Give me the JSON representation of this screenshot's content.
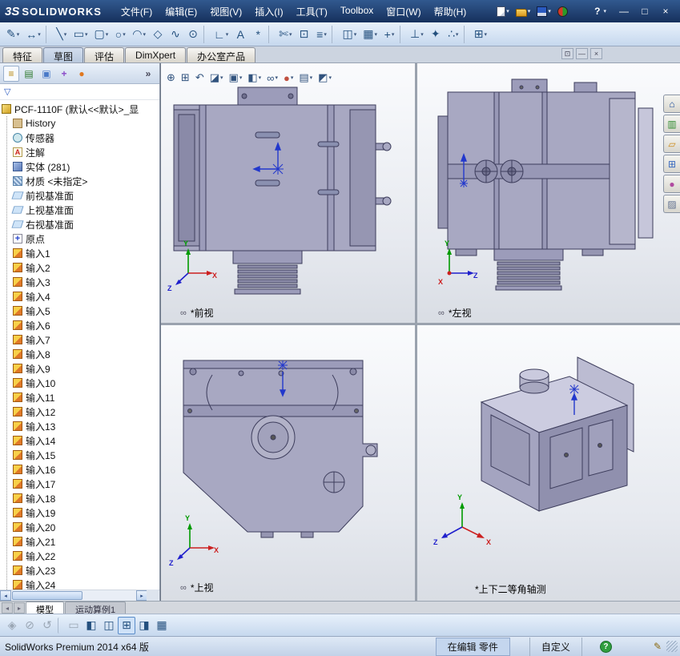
{
  "ui": {
    "caret": "▾",
    "arrow_up": "▴",
    "arrow_down": "▾",
    "arrow_left": "◂",
    "arrow_right": "▸"
  },
  "axis": {
    "x": "X",
    "y": "Y",
    "z": "Z"
  },
  "icons": {
    "view_icon": "∞",
    "filter_icon": "▽",
    "grip": ""
  },
  "titlebar": {
    "logo_mark": "3S",
    "logo_text": "SOLIDWORKS",
    "menus": [
      "文件(F)",
      "编辑(E)",
      "视图(V)",
      "插入(I)",
      "工具(T)",
      "Toolbox",
      "窗口(W)",
      "帮助(H)"
    ],
    "icons": [
      {
        "name": "new-document-icon",
        "type": "page",
        "caret": true
      },
      {
        "name": "open-icon",
        "type": "folder",
        "caret": true
      },
      {
        "name": "save-icon",
        "type": "disk",
        "caret": true
      },
      {
        "name": "options-icon",
        "type": "rg",
        "caret": false
      }
    ],
    "help": "?",
    "window_buttons": [
      {
        "name": "minimize-button",
        "glyph": "—"
      },
      {
        "name": "maximize-button",
        "glyph": "□"
      },
      {
        "name": "close-button",
        "glyph": "×"
      }
    ]
  },
  "toolbar": {
    "icons": [
      {
        "name": "sketch-icon",
        "glyph": "✎",
        "caret": true
      },
      {
        "name": "smart-dimension-icon",
        "glyph": "↔",
        "caret": true
      },
      {
        "name": "separator",
        "sep": true,
        "cls": "sep"
      },
      {
        "name": "line-icon",
        "glyph": "╲",
        "caret": true
      },
      {
        "name": "rectangle-icon",
        "glyph": "▭",
        "caret": true
      },
      {
        "name": "slot-icon",
        "glyph": "▢",
        "caret": true
      },
      {
        "name": "circle-icon",
        "glyph": "○",
        "caret": true
      },
      {
        "name": "arc-icon",
        "glyph": "◠",
        "caret": true
      },
      {
        "name": "polygon-icon",
        "glyph": "◇",
        "caret": false
      },
      {
        "name": "spline-icon",
        "glyph": "∿",
        "caret": false
      },
      {
        "name": "ellipse-icon",
        "glyph": "⊙",
        "caret": false
      },
      {
        "name": "separator",
        "sep": true,
        "cls": "sep"
      },
      {
        "name": "sketch-fillet-icon",
        "glyph": "∟",
        "caret": true
      },
      {
        "name": "text-icon",
        "glyph": "A",
        "caret": false
      },
      {
        "name": "point-icon",
        "glyph": "*",
        "caret": false
      },
      {
        "name": "separator",
        "sep": true,
        "cls": "sep"
      },
      {
        "name": "trim-entities-icon",
        "glyph": "✄",
        "caret": true
      },
      {
        "name": "convert-entities-icon",
        "glyph": "⊡",
        "caret": false
      },
      {
        "name": "offset-entities-icon",
        "glyph": "≡",
        "caret": true
      },
      {
        "name": "separator",
        "sep": true,
        "cls": "sep"
      },
      {
        "name": "mirror-entities-icon",
        "glyph": "◫",
        "caret": true
      },
      {
        "name": "linear-pattern-icon",
        "glyph": "▦",
        "caret": true
      },
      {
        "name": "move-entities-icon",
        "glyph": "+",
        "caret": true
      },
      {
        "name": "separator",
        "sep": true,
        "cls": "sep"
      },
      {
        "name": "display-relations-icon",
        "glyph": "⊥",
        "caret": true
      },
      {
        "name": "repair-sketch-icon",
        "glyph": "✦",
        "caret": false
      },
      {
        "name": "quick-snaps-icon",
        "glyph": "∴",
        "caret": true
      },
      {
        "name": "separator",
        "sep": true,
        "cls": "sep"
      },
      {
        "name": "grid-settings-icon",
        "glyph": "⊞",
        "caret": true
      }
    ]
  },
  "ribbon": {
    "tabs": [
      {
        "label": "特征",
        "cls": ""
      },
      {
        "label": "草图",
        "cls": "active"
      },
      {
        "label": "评估",
        "cls": ""
      },
      {
        "label": "DimXpert",
        "cls": ""
      },
      {
        "label": "办公室产品",
        "cls": ""
      }
    ],
    "window_controls": [
      {
        "name": "doc-restore-icon",
        "glyph": "⊡"
      },
      {
        "name": "doc-minimize-icon",
        "glyph": "—"
      },
      {
        "name": "doc-close-icon",
        "glyph": "×"
      }
    ]
  },
  "panel": {
    "tabs": [
      {
        "name": "featuremanager-tab-icon",
        "glyph": "≡",
        "cls": "fm"
      },
      {
        "name": "propertymanager-tab-icon",
        "glyph": "▤",
        "cls": "pm"
      },
      {
        "name": "configurationmanager-tab-icon",
        "glyph": "▣",
        "cls": "cm"
      },
      {
        "name": "dimxpertmanager-tab-icon",
        "glyph": "+",
        "cls": "dx"
      },
      {
        "name": "displaymanager-tab-icon",
        "glyph": "●",
        "cls": "dm"
      },
      {
        "name": "panel-overflow-icon",
        "glyph": "»",
        "cls": "ov"
      }
    ],
    "tree": {
      "root": {
        "label": "PCF-1110F (默认<<默认>_显",
        "icon": "part"
      },
      "items": [
        {
          "label": "History",
          "icon": "history"
        },
        {
          "label": "传感器",
          "icon": "sensors"
        },
        {
          "label": "注解",
          "icon": "annotations"
        },
        {
          "label": "实体 (281)",
          "icon": "solids"
        },
        {
          "label": "材质 <未指定>",
          "icon": "material"
        },
        {
          "label": "前视基准面",
          "icon": "plane"
        },
        {
          "label": "上视基准面",
          "icon": "plane"
        },
        {
          "label": "右视基准面",
          "icon": "plane"
        },
        {
          "label": "原点",
          "icon": "origin"
        },
        {
          "label": "输入1",
          "icon": "input"
        },
        {
          "label": "输入2",
          "icon": "input"
        },
        {
          "label": "输入3",
          "icon": "input"
        },
        {
          "label": "输入4",
          "icon": "input"
        },
        {
          "label": "输入5",
          "icon": "input"
        },
        {
          "label": "输入6",
          "icon": "input"
        },
        {
          "label": "输入7",
          "icon": "input"
        },
        {
          "label": "输入8",
          "icon": "input"
        },
        {
          "label": "输入9",
          "icon": "input"
        },
        {
          "label": "输入10",
          "icon": "input"
        },
        {
          "label": "输入11",
          "icon": "input"
        },
        {
          "label": "输入12",
          "icon": "input"
        },
        {
          "label": "输入13",
          "icon": "input"
        },
        {
          "label": "输入14",
          "icon": "input"
        },
        {
          "label": "输入15",
          "icon": "input"
        },
        {
          "label": "输入16",
          "icon": "input"
        },
        {
          "label": "输入17",
          "icon": "input"
        },
        {
          "label": "输入18",
          "icon": "input"
        },
        {
          "label": "输入19",
          "icon": "input"
        },
        {
          "label": "输入20",
          "icon": "input"
        },
        {
          "label": "输入21",
          "icon": "input"
        },
        {
          "label": "输入22",
          "icon": "input"
        },
        {
          "label": "输入23",
          "icon": "input"
        },
        {
          "label": "输入24",
          "icon": "input"
        }
      ]
    }
  },
  "hud": {
    "icons": [
      {
        "name": "zoom-fit-icon",
        "glyph": "⊕",
        "caret": false
      },
      {
        "name": "zoom-area-icon",
        "glyph": "⊞",
        "caret": false
      },
      {
        "name": "previous-view-icon",
        "glyph": "↶",
        "caret": false
      },
      {
        "name": "section-view-icon",
        "glyph": "◪",
        "caret": true
      },
      {
        "name": "view-orientation-icon",
        "glyph": "▣",
        "caret": true
      },
      {
        "name": "display-style-icon",
        "glyph": "◧",
        "caret": true
      },
      {
        "name": "hide-show-items-icon",
        "glyph": "∞",
        "caret": true
      },
      {
        "name": "edit-appearance-icon",
        "glyph": "●",
        "caret": true,
        "cls": "ball"
      },
      {
        "name": "apply-scene-icon",
        "glyph": "▤",
        "caret": true
      },
      {
        "name": "view-settings-icon",
        "glyph": "◩",
        "caret": true
      }
    ]
  },
  "taskpane": {
    "icons": [
      {
        "name": "solidworks-resources-icon",
        "glyph": "⌂",
        "cls": "tp-home"
      },
      {
        "name": "design-library-icon",
        "glyph": "▥",
        "cls": "tp-lib"
      },
      {
        "name": "file-explorer-icon",
        "glyph": "▱",
        "cls": "tp-folder"
      },
      {
        "name": "view-palette-icon",
        "glyph": "⊞",
        "cls": "tp-pal"
      },
      {
        "name": "appearances-scenes-icon",
        "glyph": "●",
        "cls": "tp-ball"
      },
      {
        "name": "custom-properties-icon",
        "glyph": "▨",
        "cls": "tp-prop"
      }
    ]
  },
  "viewports": [
    {
      "label": "*前视"
    },
    {
      "label": "*左视"
    },
    {
      "label": "*上视"
    },
    {
      "label": "*上下二等角轴测"
    }
  ],
  "bottom_tabs": {
    "nav": [
      {
        "name": "tabs-scroll-left-icon",
        "glyph": "◂"
      },
      {
        "name": "tabs-scroll-right-icon",
        "glyph": "▸"
      }
    ],
    "tabs": [
      {
        "label": "模型",
        "cls": "active"
      },
      {
        "label": "运动算例1",
        "cls": ""
      }
    ]
  },
  "bottom_toolbar": {
    "icons": [
      {
        "name": "mass-properties-icon",
        "glyph": "◈",
        "cls": "dis"
      },
      {
        "name": "measure-icon",
        "glyph": "⊘",
        "cls": "dis"
      },
      {
        "name": "undo-view-icon",
        "glyph": "↺",
        "cls": "dis"
      },
      {
        "name": "separator",
        "sep": true,
        "cls": "sep"
      },
      {
        "name": "evaluate-icon",
        "glyph": "▭",
        "cls": "dis"
      },
      {
        "name": "section-view-icon",
        "glyph": "◧",
        "cls": ""
      },
      {
        "name": "view-orientation-icon",
        "glyph": "◫",
        "cls": ""
      },
      {
        "name": "four-viewport-icon",
        "glyph": "⊞",
        "cls": "act"
      },
      {
        "name": "display-style-icon",
        "glyph": "◨",
        "cls": ""
      },
      {
        "name": "apply-scene-icon",
        "glyph": "▦",
        "cls": ""
      }
    ]
  },
  "statusbar": {
    "product": "SolidWorks Premium 2014 x64 版",
    "editing_status": "在编辑 零件",
    "customize_label": "自定义",
    "help_glyph": "?",
    "edit_icon_glyph": "✎"
  }
}
